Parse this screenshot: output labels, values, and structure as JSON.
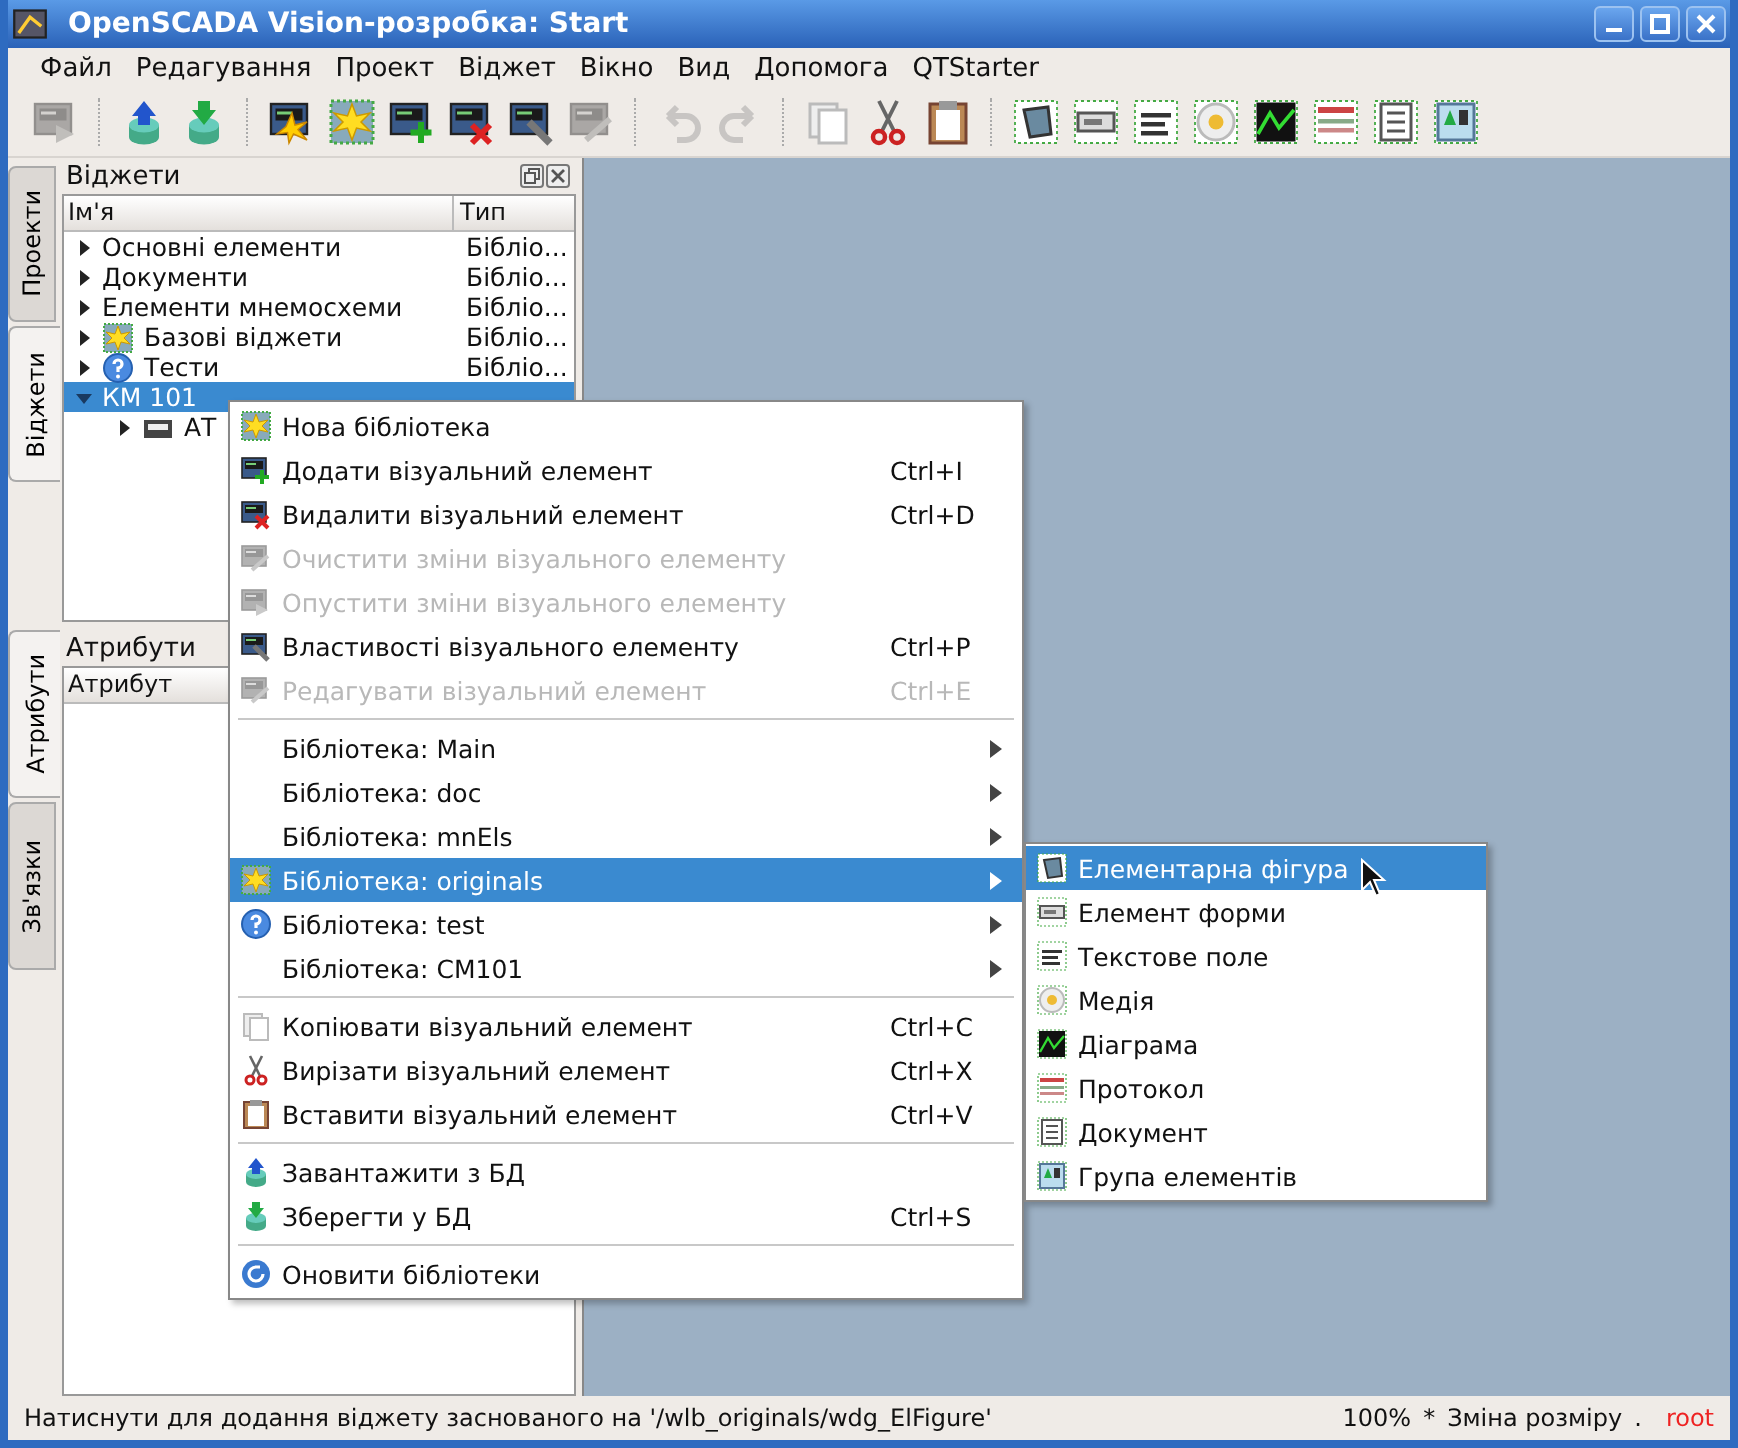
{
  "window": {
    "title": "OpenSCADA Vision-розробка: Start"
  },
  "menubar": [
    {
      "label": "Файл"
    },
    {
      "label": "Редагування"
    },
    {
      "label": "Проект"
    },
    {
      "label": "Віджет"
    },
    {
      "label": "Вікно"
    },
    {
      "label": "Вид"
    },
    {
      "label": "Допомога"
    },
    {
      "label": "QTStarter"
    }
  ],
  "toolbar": [
    {
      "kind": "screen-play",
      "disabled": true
    },
    {
      "kind": "separator"
    },
    {
      "kind": "db-up",
      "disabled": false
    },
    {
      "kind": "db-down",
      "disabled": false
    },
    {
      "kind": "separator"
    },
    {
      "kind": "screen-star",
      "disabled": false
    },
    {
      "kind": "star",
      "disabled": false
    },
    {
      "kind": "screen-add",
      "disabled": false
    },
    {
      "kind": "screen-del",
      "disabled": false
    },
    {
      "kind": "screen-wrench",
      "disabled": false
    },
    {
      "kind": "screen-edit",
      "disabled": true
    },
    {
      "kind": "separator"
    },
    {
      "kind": "undo",
      "disabled": true
    },
    {
      "kind": "redo",
      "disabled": true
    },
    {
      "kind": "separator"
    },
    {
      "kind": "copy",
      "disabled": false
    },
    {
      "kind": "cut",
      "disabled": false
    },
    {
      "kind": "paste",
      "disabled": false
    },
    {
      "kind": "separator"
    },
    {
      "kind": "shape",
      "disabled": false
    },
    {
      "kind": "form",
      "disabled": false
    },
    {
      "kind": "text",
      "disabled": false
    },
    {
      "kind": "media",
      "disabled": false
    },
    {
      "kind": "diagram",
      "disabled": false
    },
    {
      "kind": "protocol",
      "disabled": false
    },
    {
      "kind": "document",
      "disabled": false
    },
    {
      "kind": "group",
      "disabled": false
    }
  ],
  "side_tabs": [
    [
      {
        "label": "Проекти",
        "selected": false
      },
      {
        "label": "Віджети",
        "selected": true
      }
    ],
    [
      {
        "label": "Атрибути",
        "selected": true
      },
      {
        "label": "Зв'язки",
        "selected": false
      }
    ]
  ],
  "widgets_panel": {
    "title": "Віджети",
    "columns": [
      "Ім'я",
      "Тип"
    ],
    "tree": [
      {
        "label": "Основні елементи",
        "type": "Бібліо...",
        "kind": "plain",
        "expanded": false,
        "selected": false
      },
      {
        "label": "Документи",
        "type": "Бібліо...",
        "kind": "plain",
        "expanded": false,
        "selected": false
      },
      {
        "label": "Елементи мнемосхеми",
        "type": "Бібліо...",
        "kind": "plain",
        "expanded": false,
        "selected": false
      },
      {
        "label": "Базові віджети",
        "type": "Бібліо...",
        "kind": "star",
        "expanded": false,
        "selected": false
      },
      {
        "label": "Тести",
        "type": "Бібліо...",
        "kind": "help",
        "expanded": false,
        "selected": false
      },
      {
        "label": "КМ 101",
        "kind": "plain",
        "expanded": true,
        "selected": true,
        "children": [
          {
            "label": "АТ",
            "kind": "drive",
            "expanded": false,
            "selected": false
          }
        ]
      }
    ]
  },
  "attributes_panel": {
    "title": "Атрибути",
    "columns": [
      "Атрибут"
    ]
  },
  "context_menu": [
    {
      "kind": "star",
      "label": "Нова бібліотека",
      "disabled": false,
      "submenu": false,
      "selected": false
    },
    {
      "kind": "screen-add",
      "label": "Додати візуальний елемент",
      "shortcut": "Ctrl+I",
      "disabled": false,
      "submenu": false,
      "selected": false
    },
    {
      "kind": "screen-del",
      "label": "Видалити візуальний елемент",
      "shortcut": "Ctrl+D",
      "disabled": false,
      "submenu": false,
      "selected": false
    },
    {
      "kind": "screen-edit",
      "label": "Очистити зміни візуального елементу",
      "disabled": true,
      "submenu": false,
      "selected": false
    },
    {
      "kind": "screen-play",
      "label": "Опустити зміни візуального елементу",
      "disabled": true,
      "submenu": false,
      "selected": false
    },
    {
      "kind": "screen-wrench",
      "label": "Властивості візуального елементу",
      "shortcut": "Ctrl+P",
      "disabled": false,
      "submenu": false,
      "selected": false
    },
    {
      "kind": "screen-edit",
      "label": "Редагувати візуальний елемент",
      "shortcut": "Ctrl+E",
      "disabled": true,
      "submenu": false,
      "selected": false
    },
    {
      "kind": "separator"
    },
    {
      "kind": "plain",
      "label": "Бібліотека: Main",
      "disabled": false,
      "submenu": true,
      "selected": false
    },
    {
      "kind": "plain",
      "label": "Бібліотека: doc",
      "disabled": false,
      "submenu": true,
      "selected": false
    },
    {
      "kind": "plain",
      "label": "Бібліотека: mnEls",
      "disabled": false,
      "submenu": true,
      "selected": false
    },
    {
      "kind": "star",
      "label": "Бібліотека: originals",
      "disabled": false,
      "submenu": true,
      "selected": true
    },
    {
      "kind": "help",
      "label": "Бібліотека: test",
      "disabled": false,
      "submenu": true,
      "selected": false
    },
    {
      "kind": "plain",
      "label": "Бібліотека: CM101",
      "disabled": false,
      "submenu": true,
      "selected": false
    },
    {
      "kind": "separator"
    },
    {
      "kind": "copy",
      "label": "Копіювати візуальний елемент",
      "shortcut": "Ctrl+C",
      "disabled": false,
      "submenu": false,
      "selected": false
    },
    {
      "kind": "cut",
      "label": "Вирізати візуальний елемент",
      "shortcut": "Ctrl+X",
      "disabled": false,
      "submenu": false,
      "selected": false
    },
    {
      "kind": "paste",
      "label": "Вставити візуальний елемент",
      "shortcut": "Ctrl+V",
      "disabled": false,
      "submenu": false,
      "selected": false
    },
    {
      "kind": "separator"
    },
    {
      "kind": "db-up",
      "label": "Завантажити з БД",
      "disabled": false,
      "submenu": false,
      "selected": false
    },
    {
      "kind": "db-down",
      "label": "Зберегти у БД",
      "shortcut": "Ctrl+S",
      "disabled": false,
      "submenu": false,
      "selected": false
    },
    {
      "kind": "separator"
    },
    {
      "kind": "refresh",
      "label": "Оновити бібліотеки",
      "disabled": false,
      "submenu": false,
      "selected": false
    }
  ],
  "submenu": [
    {
      "label": "Елементарна фігура",
      "kind": "shape",
      "selected": true
    },
    {
      "label": "Елемент форми",
      "kind": "form",
      "selected": false
    },
    {
      "label": "Текстове поле",
      "kind": "text",
      "selected": false
    },
    {
      "label": "Медія",
      "kind": "media",
      "selected": false
    },
    {
      "label": "Діаграма",
      "kind": "diagram",
      "selected": false
    },
    {
      "label": "Протокол",
      "kind": "protocol",
      "selected": false
    },
    {
      "label": "Документ",
      "kind": "document",
      "selected": false
    },
    {
      "label": "Група елементів",
      "kind": "group",
      "selected": false
    }
  ],
  "status_bar": {
    "message": "Натиснути для додання віджету заснованого на '/wlb_originals/wdg_ElFigure'",
    "zoom": "100%",
    "modified": "*",
    "mode": "Зміна розміру",
    "separator": ".",
    "user": "root"
  }
}
